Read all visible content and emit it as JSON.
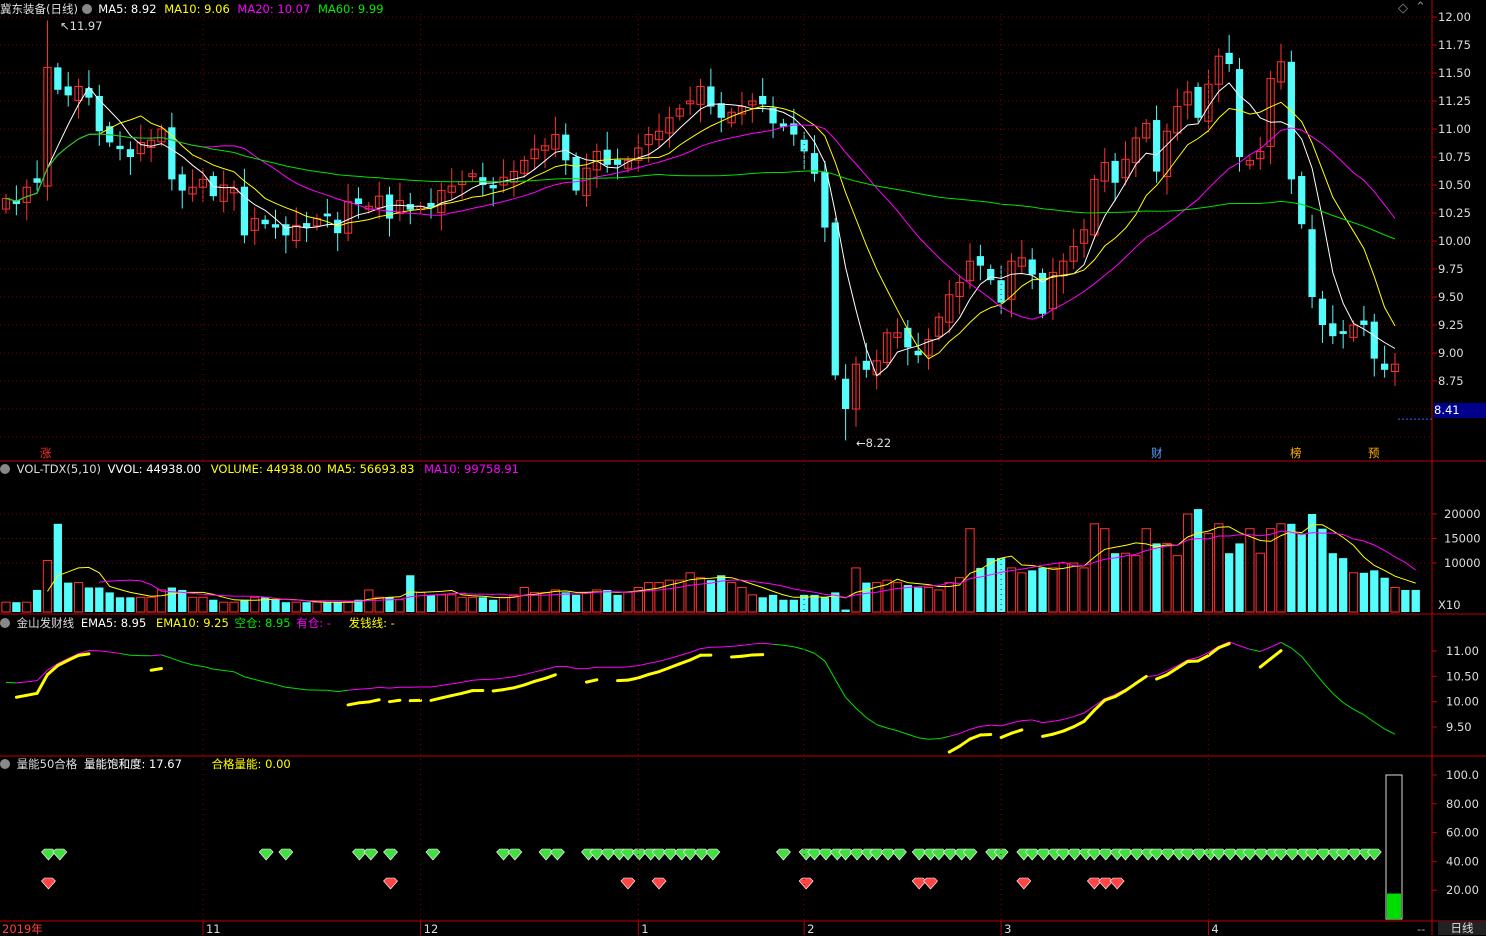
{
  "colors": {
    "up": "#ff3232",
    "down": "#54fcfc",
    "ma5": "#ffffff",
    "ma10": "#ffff00",
    "ma20": "#ff00ff",
    "ma60": "#00e000",
    "grid": "#800000",
    "axis": "#c00000",
    "label": "#dddddd",
    "price_box": "#00008b",
    "hl": "#ffff00"
  },
  "main": {
    "title": "冀东装备(日线)",
    "ma5_label": "MA5: 8.92",
    "ma10_label": "MA10: 9.06",
    "ma20_label": "MA20: 10.07",
    "ma60_label": "MA60: 9.99",
    "high_label": "11.97",
    "low_label": "8.22",
    "current_price": "8.41",
    "markers": [
      {
        "text": "涨",
        "color": "#ff3232"
      },
      {
        "text": "财",
        "color": "#54a0ff"
      },
      {
        "text": "榜",
        "color": "#ffb000"
      },
      {
        "text": "预",
        "color": "#ffb000"
      }
    ]
  },
  "vol": {
    "title": "VOL-TDX(5,10)",
    "vvol": "VVOL: 44938.00",
    "volume": "VOLUME: 44938.00",
    "ma5": "MA5: 56693.83",
    "ma10": "MA10: 99758.91",
    "unit": "X10"
  },
  "jin": {
    "title": "金山发财线",
    "ema5": "EMA5: 8.95",
    "ema10": "EMA10: 9.25",
    "kong": "空仓: 8.95",
    "you": "有仓: -",
    "fa": "发钱线: -"
  },
  "liang": {
    "title": "量能50合格",
    "sat": "量能饱和度: 17.67",
    "hege": "合格量能: 0.00"
  },
  "bottom": {
    "year": "2019年",
    "tab": "日线",
    "dash": "--"
  },
  "chart_data": [
    {
      "type": "candlestick",
      "name": "冀东装备(日线)",
      "ylim": [
        8.0,
        12.0
      ],
      "y_ticks": [
        "12.00",
        "11.75",
        "11.50",
        "11.25",
        "11.00",
        "10.75",
        "10.50",
        "10.25",
        "10.00",
        "9.75",
        "9.50",
        "9.25",
        "9.00",
        "8.75"
      ],
      "x_labels": [
        "2019年",
        "11",
        "12",
        "1",
        "2",
        "3",
        "4"
      ],
      "close": [
        10.38,
        10.33,
        10.48,
        10.52,
        11.55,
        11.35,
        11.3,
        11.38,
        11.28,
        10.98,
        10.88,
        10.82,
        10.75,
        10.88,
        10.9,
        11.0,
        10.55,
        10.45,
        10.48,
        10.55,
        10.4,
        10.5,
        10.47,
        10.05,
        10.2,
        10.15,
        10.12,
        10.05,
        10.14,
        10.12,
        10.2,
        10.22,
        10.07,
        10.35,
        10.33,
        10.31,
        10.4,
        10.2,
        10.36,
        10.28,
        10.31,
        10.3,
        10.45,
        10.49,
        10.53,
        10.6,
        10.5,
        10.47,
        10.57,
        10.62,
        10.72,
        10.82,
        10.85,
        10.95,
        10.72,
        10.45,
        10.65,
        10.8,
        10.68,
        10.68,
        10.72,
        10.83,
        10.95,
        10.98,
        11.1,
        11.18,
        11.25,
        11.38,
        11.2,
        11.1,
        11.15,
        11.2,
        11.25,
        11.22,
        11.05,
        11.02,
        10.95,
        10.8,
        10.6,
        10.12,
        8.8,
        8.5,
        8.9,
        8.85,
        8.93,
        9.18,
        9.18,
        9.05,
        8.98,
        9.12,
        9.32,
        9.52,
        9.63,
        9.82,
        9.78,
        9.65,
        9.45,
        9.82,
        9.85,
        9.7,
        9.35,
        9.72,
        9.82,
        9.95,
        10.1,
        10.55,
        10.7,
        10.52,
        10.73,
        10.92,
        11.05,
        10.62,
        10.98,
        11.2,
        11.33,
        11.1,
        11.4,
        11.65,
        11.58,
        10.75,
        10.72,
        10.8,
        11.45,
        11.6,
        10.55,
        10.15,
        9.5,
        9.25,
        9.15,
        9.17,
        9.25,
        9.25,
        8.95,
        8.85,
        8.9
      ],
      "ma5_last": 8.92,
      "ma10_last": 9.06,
      "ma20_last": 10.07,
      "ma60_last": 9.99,
      "marked_high": 11.97,
      "marked_low": 8.22
    },
    {
      "type": "bar",
      "name": "VOL-TDX(5,10)",
      "ylim": [
        0,
        28000
      ],
      "y_ticks": [
        "20000",
        "15000",
        "10000"
      ],
      "unit": "X10",
      "values": [
        2000,
        2000,
        2000,
        4500,
        10500,
        18000,
        6000,
        6000,
        5000,
        5000,
        4000,
        3000,
        3000,
        3000,
        3000,
        4500,
        5000,
        4500,
        3000,
        3000,
        2500,
        2000,
        2000,
        2500,
        3000,
        3000,
        2500,
        2000,
        2000,
        2000,
        2000,
        2000,
        2000,
        2000,
        2500,
        4500,
        3000,
        3000,
        2500,
        7500,
        4000,
        3500,
        3500,
        3500,
        3000,
        3000,
        3000,
        2500,
        3000,
        3500,
        5000,
        4000,
        4000,
        4500,
        4000,
        3500,
        4000,
        4500,
        4500,
        3500,
        4000,
        5000,
        6000,
        6000,
        6500,
        6500,
        8000,
        7000,
        6500,
        7500,
        6000,
        5000,
        3500,
        3000,
        3500,
        2500,
        2500,
        3500,
        3500,
        3000,
        4000,
        500,
        9000,
        6000,
        6000,
        6500,
        6000,
        5500,
        5000,
        5000,
        4500,
        6000,
        7000,
        17000,
        9000,
        11000,
        11000,
        9000,
        8000,
        8500,
        9000,
        9000,
        10000,
        10000,
        9000,
        18000,
        17000,
        12000,
        12000,
        11500,
        17000,
        14000,
        14000,
        11500,
        20000,
        21000,
        16000,
        18000,
        12000,
        14000,
        17000,
        12000,
        17000,
        18000,
        18000,
        16000,
        20000,
        17000,
        12000,
        11000,
        8000,
        8000,
        8500,
        7000,
        5000,
        4500,
        4500
      ],
      "ma5_last": 56693.83,
      "ma10_last": 99758.91,
      "vvol": 44938.0
    },
    {
      "type": "line",
      "name": "金山发财线",
      "ylim": [
        8.8,
        11.5
      ],
      "y_ticks": [
        "11.00",
        "10.50",
        "10.00",
        "9.50"
      ],
      "ema5_last": 8.95,
      "ema10_last": 9.25,
      "kong_last": 8.95
    },
    {
      "type": "bar",
      "name": "量能50合格",
      "ylim": [
        0,
        110
      ],
      "y_ticks": [
        "100.0",
        "80.00",
        "60.00",
        "40.00",
        "20.00"
      ],
      "saturation": 17.67,
      "qualified": 0.0
    }
  ]
}
